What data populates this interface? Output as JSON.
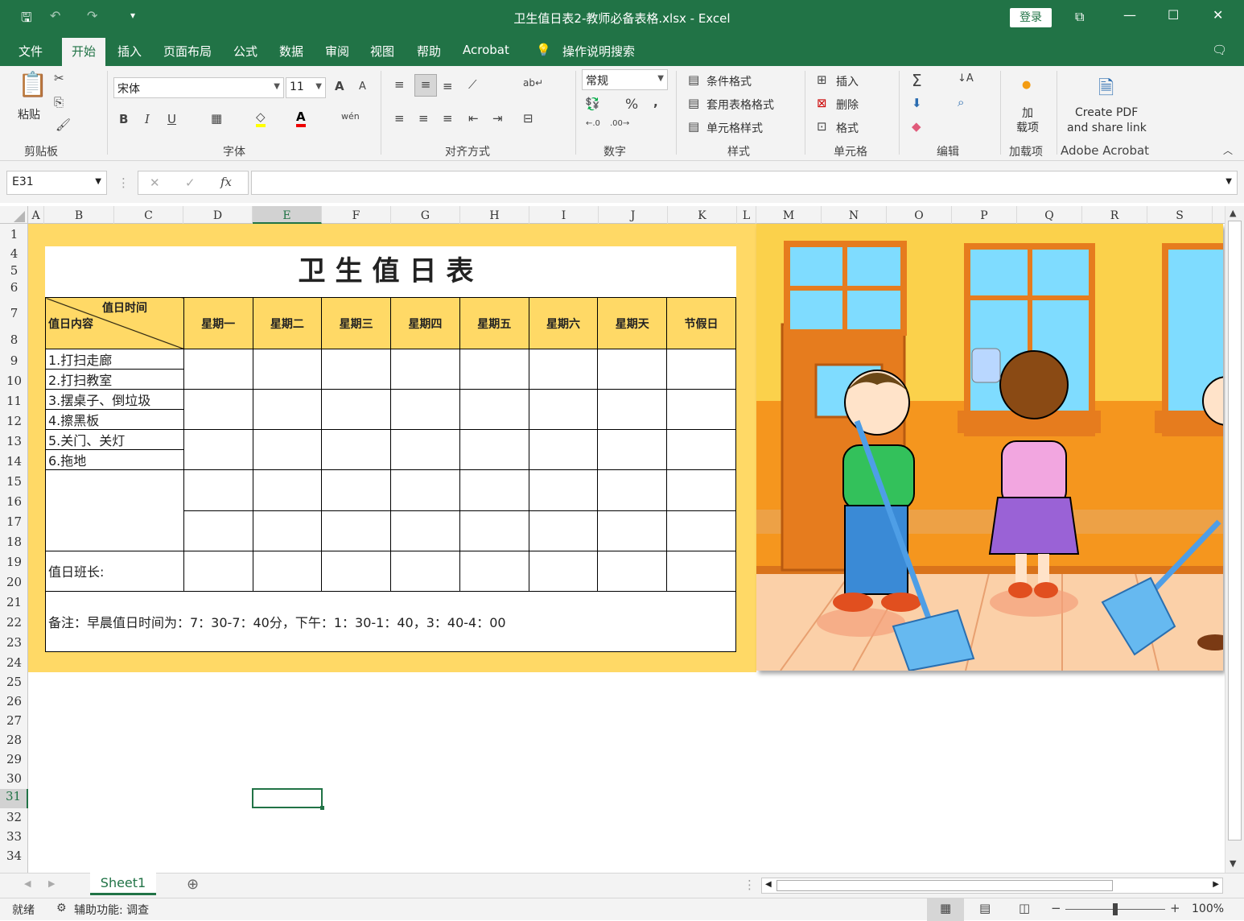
{
  "window": {
    "title": "卫生值日表2-教师必备表格.xlsx  -  Excel",
    "login_label": "登录"
  },
  "tabs": [
    "文件",
    "开始",
    "插入",
    "页面布局",
    "公式",
    "数据",
    "审阅",
    "视图",
    "帮助",
    "Acrobat"
  ],
  "search_label": "操作说明搜索",
  "ribbon": {
    "clipboard": {
      "paste": "粘贴",
      "group": "剪贴板"
    },
    "font": {
      "name": "宋体",
      "size": "11",
      "bold": "B",
      "italic": "I",
      "underline": "U",
      "group": "字体",
      "grow": "A",
      "shrink": "A"
    },
    "alignment": {
      "group": "对齐方式"
    },
    "number": {
      "format": "常规",
      "percent": "%",
      "comma": ",",
      "group": "数字"
    },
    "styles": {
      "cond": "条件格式",
      "table": "套用表格格式",
      "cell": "单元格样式",
      "group": "样式"
    },
    "cells": {
      "insert": "插入",
      "delete": "删除",
      "format": "格式",
      "group": "单元格"
    },
    "editing": {
      "group": "编辑"
    },
    "addins": {
      "label": "加\n载项",
      "group": "加载项"
    },
    "acrobat": {
      "line1": "Create PDF",
      "line2": "and share link",
      "group": "Adobe Acrobat"
    }
  },
  "namebox": "E31",
  "fx": "fx",
  "columns": [
    "A",
    "B",
    "C",
    "D",
    "E",
    "F",
    "G",
    "H",
    "I",
    "J",
    "K",
    "L",
    "M",
    "N",
    "O",
    "P",
    "Q",
    "R",
    "S"
  ],
  "rows": [
    "1",
    "4",
    "5",
    "6",
    "7",
    "8",
    "9",
    "10",
    "11",
    "12",
    "13",
    "14",
    "15",
    "16",
    "17",
    "18",
    "19",
    "20",
    "21",
    "22",
    "23",
    "24",
    "25",
    "26",
    "27",
    "28",
    "29",
    "30",
    "31",
    "32",
    "33",
    "34"
  ],
  "table": {
    "title": "卫生值日表",
    "header_time": "值日时间",
    "header_content": "值日内容",
    "days": [
      "星期一",
      "星期二",
      "星期三",
      "星期四",
      "星期五",
      "星期六",
      "星期天",
      "节假日"
    ],
    "tasks": [
      "1.打扫走廊",
      "2.打扫教室",
      "3.摆桌子、倒垃圾",
      "4.擦黑板",
      "5.关门、关灯",
      "6.拖地"
    ],
    "monitor": "值日班长:",
    "note": "备注：早晨值日时间为：7：30-7：40分，下午：1：30-1：40，3：40-4：00"
  },
  "sheet_tab": "Sheet1",
  "status": {
    "ready": "就绪",
    "accessibility": "辅助功能: 调查",
    "zoom": "100%"
  },
  "colors": {
    "excel_green": "#217346",
    "table_yellow": "#ffd966"
  }
}
